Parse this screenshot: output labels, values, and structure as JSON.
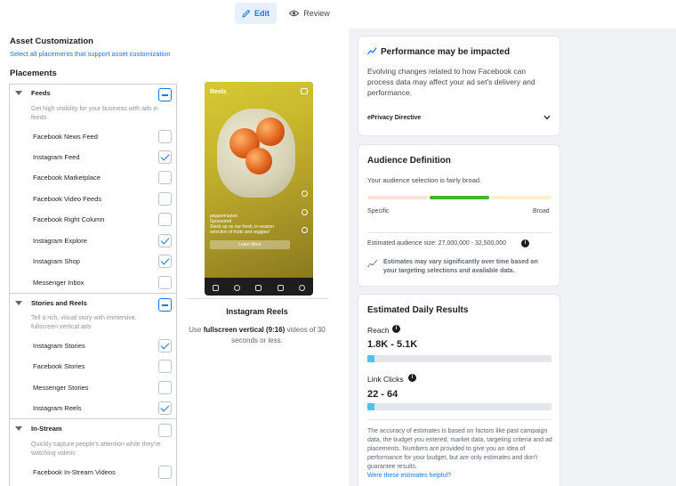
{
  "tabs": {
    "edit": "Edit",
    "review": "Review"
  },
  "left": {
    "asset_title": "Asset Customization",
    "select_all": "Select all placements that support asset customization",
    "placements_title": "Placements",
    "groups": [
      {
        "name": "Feeds",
        "desc": "Get high visibility for your business with ads in feeds",
        "items": [
          {
            "label": "Facebook News Feed",
            "checked": false
          },
          {
            "label": "Instagram Feed",
            "checked": true
          },
          {
            "label": "Facebook Marketplace",
            "checked": false
          },
          {
            "label": "Facebook Video Feeds",
            "checked": false
          },
          {
            "label": "Facebook Right Column",
            "checked": false
          },
          {
            "label": "Instagram Explore",
            "checked": true
          },
          {
            "label": "Instagram Shop",
            "checked": true
          },
          {
            "label": "Messenger Inbox",
            "checked": false
          }
        ]
      },
      {
        "name": "Stories and Reels",
        "desc": "Tell a rich, visual story with immersive, fullscreen vertical ads",
        "items": [
          {
            "label": "Instagram Stories",
            "checked": true
          },
          {
            "label": "Facebook Stories",
            "checked": false
          },
          {
            "label": "Messenger Stories",
            "checked": false
          },
          {
            "label": "Instagram Reels",
            "checked": true
          }
        ]
      },
      {
        "name": "In-Stream",
        "desc": "Quickly capture people's attention while they're watching videos",
        "items": [
          {
            "label": "Facebook In-Stream Videos",
            "checked": false
          }
        ]
      }
    ]
  },
  "preview": {
    "screen_label": "Reels",
    "account": "peppermarket",
    "sponsored": "Sponsored",
    "caption": "Stock up on our fresh, in-season selection of fruits and veggies!",
    "cta": "Learn More",
    "name": "Instagram Reels",
    "desc_pre": "Use ",
    "desc_bold": "fullscreen vertical (9:16)",
    "desc_post": " videos of 30 seconds or less."
  },
  "performance": {
    "title": "Performance may be impacted",
    "body": "Evolving changes related to how Facebook can process data may affect your ad set's delivery and performance.",
    "link": "ePrivacy Directive"
  },
  "audience": {
    "title": "Audience Definition",
    "status": "Your audience selection is fairly broad.",
    "specific": "Specific",
    "broad": "Broad",
    "size": "Estimated audience size: 27,000,000 - 32,500,000",
    "note": "Estimates may vary significantly over time based on your targeting selections and available data."
  },
  "results": {
    "title": "Estimated Daily Results",
    "reach_label": "Reach",
    "reach_value": "1.8K - 5.1K",
    "reach_fill": 0.04,
    "clicks_label": "Link Clicks",
    "clicks_value": "22 - 64",
    "clicks_fill": 0.04,
    "disclaimer": "The accuracy of estimates is based on factors like past campaign data, the budget you entered, market data, targeting criteria and ad placements. Numbers are provided to give you an idea of performance for your budget, but are only estimates and don't guarantee results.",
    "helpful": "Were these estimates helpful?"
  },
  "colors": {
    "accent": "#1877f2",
    "green": "#42b72a",
    "panel_bg": "#f0f2f5"
  }
}
